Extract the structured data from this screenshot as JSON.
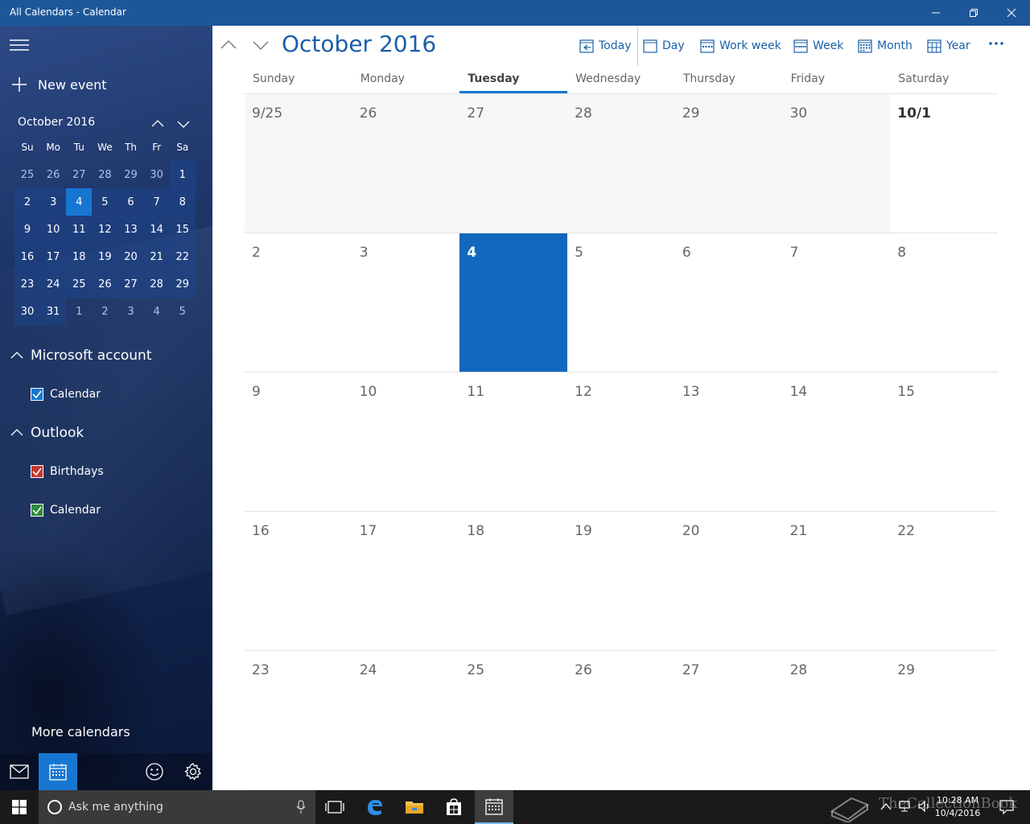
{
  "window": {
    "title": "All Calendars - Calendar"
  },
  "sidebar": {
    "new_event": "New event",
    "mini_month": "October 2016",
    "weekdays": [
      "Su",
      "Mo",
      "Tu",
      "We",
      "Th",
      "Fr",
      "Sa"
    ],
    "days": [
      "25",
      "26",
      "27",
      "28",
      "29",
      "30",
      "1",
      "2",
      "3",
      "4",
      "5",
      "6",
      "7",
      "8",
      "9",
      "10",
      "11",
      "12",
      "13",
      "14",
      "15",
      "16",
      "17",
      "18",
      "19",
      "20",
      "21",
      "22",
      "23",
      "24",
      "25",
      "26",
      "27",
      "28",
      "29",
      "30",
      "31",
      "1",
      "2",
      "3",
      "4",
      "5"
    ],
    "sections": [
      {
        "name": "Microsoft account",
        "calendars": [
          {
            "name": "Calendar",
            "color": "#1677d2"
          }
        ]
      },
      {
        "name": "Outlook",
        "calendars": [
          {
            "name": "Birthdays",
            "color": "#c6392b"
          },
          {
            "name": "Calendar",
            "color": "#2e8b3a"
          }
        ]
      }
    ],
    "more_calendars": "More calendars"
  },
  "main": {
    "title": "October 2016",
    "toolbar": {
      "today": "Today",
      "day": "Day",
      "work_week": "Work week",
      "week": "Week",
      "month": "Month",
      "year": "Year"
    },
    "weekdays": [
      "Sunday",
      "Monday",
      "Tuesday",
      "Wednesday",
      "Thursday",
      "Friday",
      "Saturday"
    ],
    "active_weekday": "Tuesday",
    "dates": [
      "9/25",
      "26",
      "27",
      "28",
      "29",
      "30",
      "10/1",
      "2",
      "3",
      "4",
      "5",
      "6",
      "7",
      "8",
      "9",
      "10",
      "11",
      "12",
      "13",
      "14",
      "15",
      "16",
      "17",
      "18",
      "19",
      "20",
      "21",
      "22",
      "23",
      "24",
      "25",
      "26",
      "27",
      "28",
      "29"
    ],
    "today": "4"
  },
  "taskbar": {
    "search_placeholder": "Ask me anything",
    "time": "10:28 AM",
    "date": "10/4/2016",
    "watermark": "TheCollectionBook"
  },
  "colors": {
    "accent": "#1677d2",
    "titlebar": "#1e5799",
    "today_cell": "#1268bd"
  }
}
